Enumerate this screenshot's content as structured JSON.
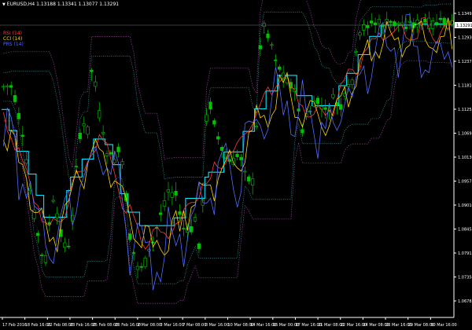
{
  "header": {
    "symbol": "EURUSD,H4",
    "ohlc": "1.13188 1.13341 1.13077 1.13291"
  },
  "legend": {
    "items": [
      {
        "label": "RSI (14)",
        "color": "#ff3b3b"
      },
      {
        "label": "CCI (14)",
        "color": "#ffd700"
      },
      {
        "label": "PRS (14)",
        "color": "#4f6cff"
      }
    ]
  },
  "price_axis": {
    "current_price": "1.13291",
    "levels": [
      "1.13495",
      "1.12930",
      "1.12375",
      "1.11810",
      "1.11255",
      "1.10695",
      "1.10130",
      "1.09575",
      "1.09010",
      "1.08455",
      "1.07915",
      "1.07350",
      "1.06785"
    ]
  },
  "time_axis": {
    "labels": [
      "17 Feb 2016",
      "18 Feb 16:00",
      "22 Feb 08:00",
      "23 Feb 16:00",
      "25 Feb 08:00",
      "26 Feb 16:00",
      "2 Mar 08:00",
      "3 Mar 16:00",
      "7 Mar 08:00",
      "8 Mar 16:00",
      "10 Mar 08:00",
      "14 Mar 16:00",
      "16 Mar 00:00",
      "17 Mar 16:00",
      "21 Mar 08:00",
      "22 Mar 16:00",
      "24 Mar 08:00",
      "26 Mar 16:00",
      "29 Mar 08:00",
      "30 Mar 16:00"
    ]
  },
  "colors": {
    "background": "#000000",
    "candles": "#00c400",
    "midline": "#00e5ff",
    "channel": "#b04bb0",
    "inner_channel": "#3fbcbc",
    "outer_channel": "#8f3f8f"
  }
}
